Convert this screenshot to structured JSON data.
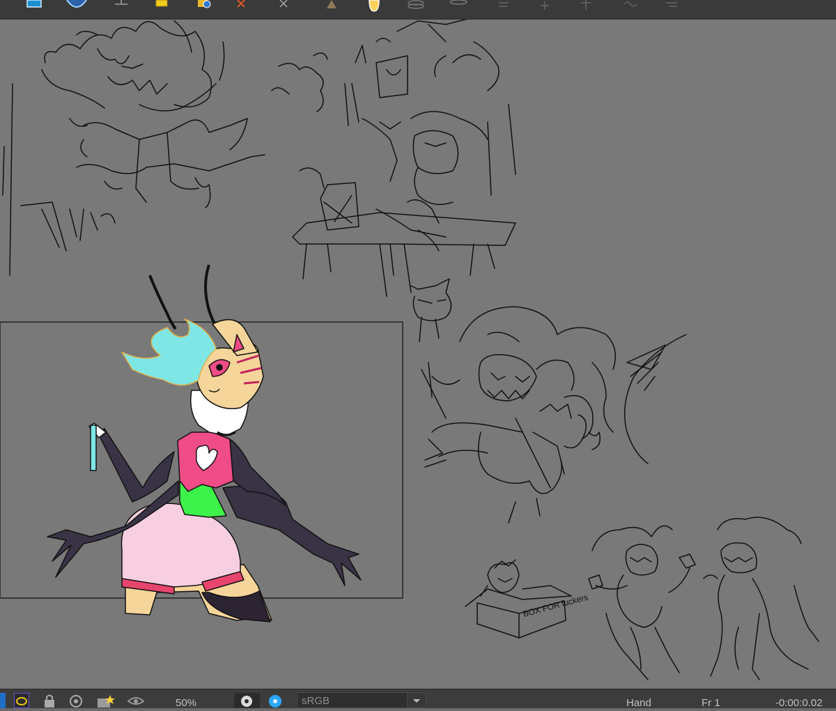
{
  "toolbar": {
    "icons": [
      "monitor-icon",
      "shield-icon",
      "layer-down-icon",
      "folder-icon",
      "globe-icon",
      "close-x-icon",
      "cursor-x-icon",
      "cone-icon",
      "bell-icon",
      "stack-icon",
      "disk-icon",
      "align-icon",
      "plus-icon",
      "move-icon",
      "curve-icon",
      "list-icon"
    ]
  },
  "canvas": {
    "background": "#797979",
    "frame_border": "#222222",
    "character_colors": {
      "hair": "#7fe6e6",
      "skin": "#f6d59b",
      "fur": "#ffffff",
      "top": "#f04c87",
      "corset": "#3df24a",
      "shorts": "#f7cfe0",
      "gloves": "#3a3346",
      "stripes": "#c2245d"
    },
    "box_text": "BOX FOR fuckers"
  },
  "status": {
    "zoom": "50%",
    "color_space": "sRGB",
    "tool": "Hand",
    "frame": "Fr 1",
    "time": "-0:00:0.02"
  }
}
